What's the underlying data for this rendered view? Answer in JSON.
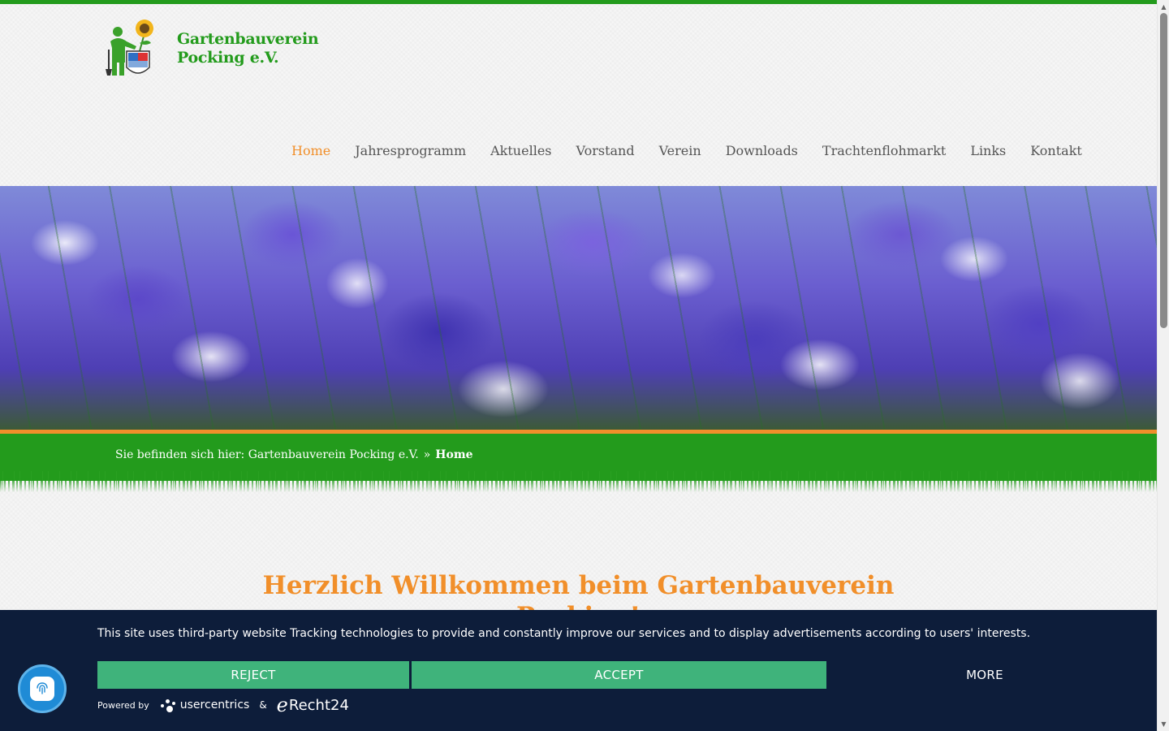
{
  "site": {
    "title_line1": "Gartenbauverein",
    "title_line2": "Pocking e.V.",
    "logo_icon": "gardener-sunflower-crest-icon",
    "colors": {
      "green": "#239b1c",
      "orange": "#f18f2a",
      "banner_bg": "#0d1d3a",
      "button": "#3fb37b"
    }
  },
  "nav": {
    "items": [
      {
        "label": "Home",
        "active": true
      },
      {
        "label": "Jahresprogramm"
      },
      {
        "label": "Aktuelles"
      },
      {
        "label": "Vorstand"
      },
      {
        "label": "Verein"
      },
      {
        "label": "Downloads"
      },
      {
        "label": "Trachtenflohmarkt"
      },
      {
        "label": "Links"
      },
      {
        "label": "Kontakt"
      }
    ]
  },
  "breadcrumb": {
    "prefix": "Sie befinden sich hier:",
    "parent": "Gartenbauverein Pocking e.V.",
    "separator": "»",
    "current": "Home"
  },
  "main": {
    "welcome_line1": "Herzlich Willkommen beim Gartenbauverein",
    "welcome_line2": "Pocking!"
  },
  "cookie_banner": {
    "text": "This site uses third-party website Tracking technologies to provide and constantly improve our services and to display advertisements according to users' interests.",
    "reject_label": "REJECT",
    "accept_label": "ACCEPT",
    "more_label": "MORE",
    "powered_by": "Powered by",
    "usercentrics": "usercentrics",
    "ampersand": "&",
    "erecht_script": "e",
    "erecht_text": "Recht24"
  },
  "privacy_button": {
    "icon": "fingerprint-icon"
  }
}
